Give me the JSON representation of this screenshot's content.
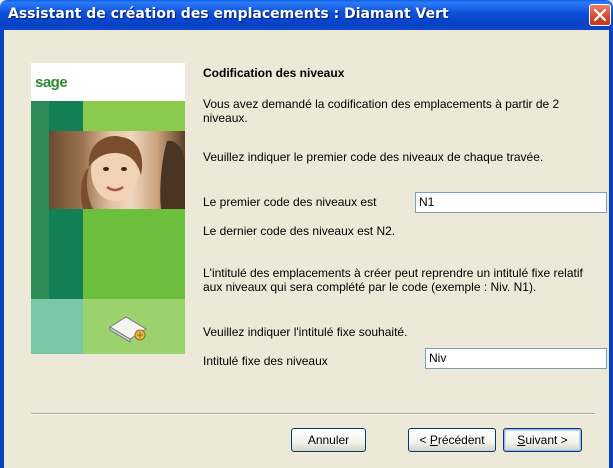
{
  "window": {
    "title": "Assistant de création des emplacements : Diamant Vert",
    "close_icon": "close-icon"
  },
  "art": {
    "logo": "sage",
    "icon": "label-tag-icon"
  },
  "content": {
    "heading": "Codification des niveaux",
    "intro": "Vous avez demandé la codification des emplacements à partir de 2 niveaux.",
    "instruction": "Veuillez indiquer le premier code des niveaux de chaque travée.",
    "first_code_label": "Le premier code des niveaux est",
    "first_code_value": "N1",
    "last_code_text": "Le dernier code des niveaux est N2.",
    "fixed_label_explanation": "L'intitulé des emplacements à créer peut reprendre un intitulé fixe relatif aux niveaux qui sera complété par le code (exemple : Niv. N1).",
    "fixed_label_instruction": "Veuillez indiquer l'intitulé fixe souhaité.",
    "fixed_label_label": "Intitulé fixe des niveaux",
    "fixed_label_value": "Niv"
  },
  "buttons": {
    "cancel": "Annuler",
    "previous_prefix": "< ",
    "previous_mnemonic": "P",
    "previous_rest": "récédent",
    "next_mnemonic": "S",
    "next_rest": "uivant >"
  }
}
